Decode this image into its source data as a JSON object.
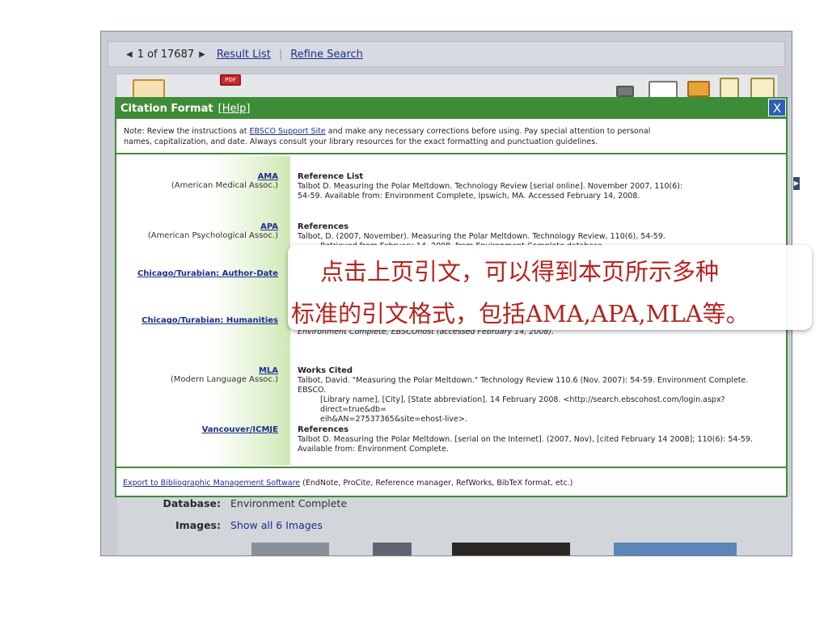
{
  "nav": {
    "counter": "1 of 17687",
    "result_list": "Result List",
    "refine_search": "Refine Search"
  },
  "toolbar": {
    "pdf_label": "PDF"
  },
  "dialog": {
    "title": "Citation Format",
    "help": "Help",
    "close": "X",
    "note_pre": "Note: Review the instructions at ",
    "note_link": "EBSCO Support Site",
    "note_post1": " and make any necessary corrections before using. Pay special attention to personal",
    "note_post2": "names, capitalization, and date. Always consult your library resources for the exact formatting and punctuation guidelines.",
    "styles": [
      {
        "name": "AMA",
        "desc": "(American Medical Assoc.)",
        "header": "Reference List",
        "line1": "Talbot D. Measuring the Polar Meltdown. Technology Review [serial online]. November 2007, 110(6):",
        "line2": "54-59. Available from: Environment Complete, Ipswich, MA. Accessed February 14, 2008."
      },
      {
        "name": "APA",
        "desc": "(American Psychological Assoc.)",
        "header": "References",
        "line1": "Talbot, D. (2007, November). Measuring the Polar Meltdown. Technology Review, 110(6), 54-59.",
        "line2": "Retrieved from February 14, 2008, from Environment Complete database."
      },
      {
        "name": "Chicago/Turabian: Author-Date",
        "desc": "",
        "header": "",
        "line1": "",
        "line2": ""
      },
      {
        "name": "Chicago/Turabian: Humanities",
        "desc": "",
        "header": "",
        "line1": "Environment Complete, EBSCOhost (accessed February 14, 2008).",
        "line2": ""
      },
      {
        "name": "MLA",
        "desc": "(Modern Language Assoc.)",
        "header": "Works Cited",
        "line1": "Talbot, David. \"Measuring the Polar Meltdown.\" Technology Review 110.6 (Nov. 2007): 54-59. Environment Complete. EBSCO.",
        "line2": "[Library name], [City], [State abbreviation]. 14 February 2008. <http://search.ebscohost.com/login.aspx?direct=true&db=",
        "line3": "eih&AN=27537365&site=ehost-live>."
      },
      {
        "name": "Vancouver/ICMJE",
        "desc": "",
        "header": "References",
        "line1": "Talbot D. Measuring the Polar Meltdown. [serial on the Internet]. (2007, Nov), [cited February 14 2008]; 110(6): 54-59.",
        "line2": "Available from: Environment Complete."
      }
    ],
    "export_link": "Export to Bibliographic Management Software",
    "export_note": " (EndNote, ProCite, Reference manager, RefWorks, BibTeX format, etc.)"
  },
  "record": {
    "database_label": "Database:",
    "database_value": "Environment Complete",
    "images_label": "Images:",
    "images_value": "Show all 6 Images"
  },
  "overlay": {
    "line1": "点击上页引文，可以得到本页所示多种",
    "line2": "标准的引文格式，包括AMA,APA,MLA等。"
  },
  "colors": {
    "dialog_green": "#3f8c38",
    "link_blue": "#1b2f8a",
    "overlay_red": "#b5231e",
    "close_blue": "#2e5fb3"
  }
}
